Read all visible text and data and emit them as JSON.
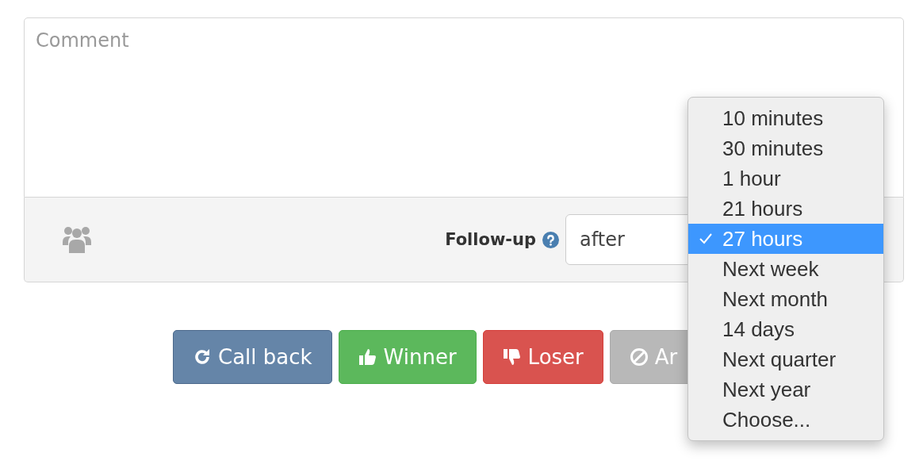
{
  "comment": {
    "placeholder": "Comment"
  },
  "follow_up": {
    "label": "Follow-up",
    "value": "after"
  },
  "buttons": [
    {
      "label": "Call back",
      "kind": "callback"
    },
    {
      "label": "Winner",
      "kind": "winner"
    },
    {
      "label": "Loser",
      "kind": "loser"
    },
    {
      "label": "Ar",
      "kind": "archive"
    }
  ],
  "menu": {
    "items": [
      {
        "label": "10 minutes",
        "selected": false
      },
      {
        "label": "30 minutes",
        "selected": false
      },
      {
        "label": "1 hour",
        "selected": false
      },
      {
        "label": "21 hours",
        "selected": false
      },
      {
        "label": "27 hours",
        "selected": true
      },
      {
        "label": "Next week",
        "selected": false
      },
      {
        "label": "Next month",
        "selected": false
      },
      {
        "label": "14 days",
        "selected": false
      },
      {
        "label": "Next quarter",
        "selected": false
      },
      {
        "label": "Next year",
        "selected": false
      },
      {
        "label": "Choose...",
        "selected": false
      }
    ]
  }
}
